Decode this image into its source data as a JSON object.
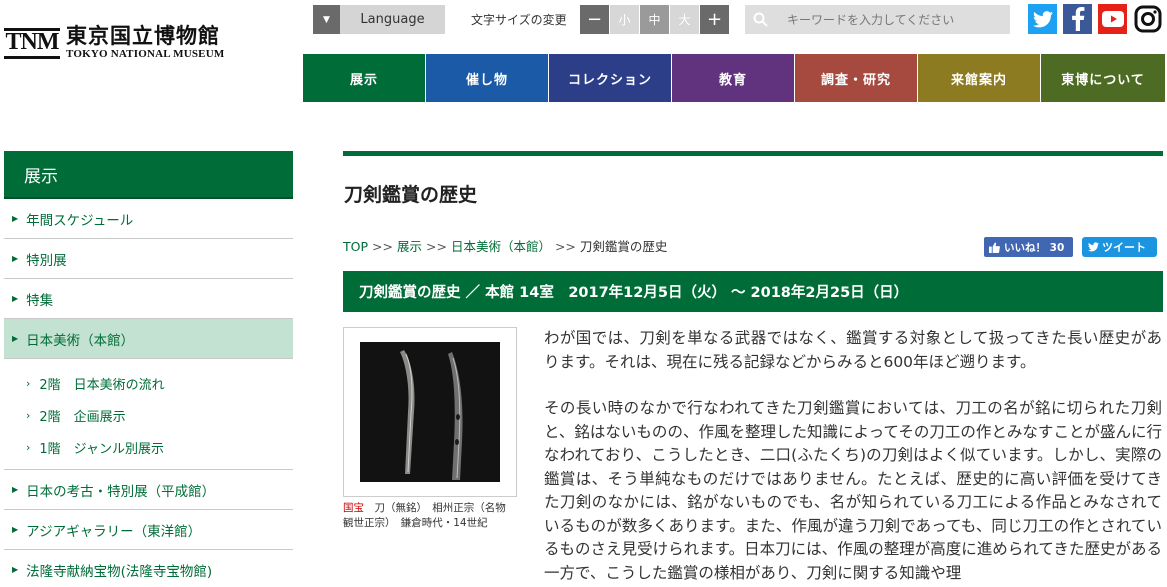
{
  "logo": {
    "mark": "TNM",
    "jp": "東京国立博物館",
    "en": "TOKYO NATIONAL MUSEUM"
  },
  "utility": {
    "language_label": "Language",
    "fontsize_label": "文字サイズの変更",
    "fs_minus": "−",
    "fs_small": "小",
    "fs_mid": "中",
    "fs_large": "大",
    "fs_plus": "+",
    "search_placeholder": "キーワードを入力してください"
  },
  "sns": {
    "twitter_color": "#1da1f2",
    "facebook_color": "#3b5998",
    "youtube_color": "#e62117"
  },
  "gnav": [
    {
      "label": "展示",
      "color": "#006d38"
    },
    {
      "label": "催し物",
      "color": "#1a5aa6"
    },
    {
      "label": "コレクション",
      "color": "#2c3e87"
    },
    {
      "label": "教育",
      "color": "#61337f"
    },
    {
      "label": "調査・研究",
      "color": "#a64a3f"
    },
    {
      "label": "来館案内",
      "color": "#8d7b21"
    },
    {
      "label": "東博について",
      "color": "#4d6b23"
    }
  ],
  "sidebar": {
    "heading": "展示",
    "items": [
      {
        "label": "年間スケジュール"
      },
      {
        "label": "特別展"
      },
      {
        "label": "特集"
      },
      {
        "label": "日本美術（本館）"
      },
      {
        "label": "日本の考古・特別展（平成館）"
      },
      {
        "label": "アジアギャラリー（東洋館）"
      },
      {
        "label": "法隆寺献納宝物(法隆寺宝物館)"
      }
    ],
    "subitems": [
      {
        "label": "2階　日本美術の流れ"
      },
      {
        "label": "2階　企画展示"
      },
      {
        "label": "1階　ジャンル別展示"
      }
    ]
  },
  "main": {
    "title": "刀剣鑑賞の歴史",
    "breadcrumb": {
      "top": "TOP",
      "sep": ">>",
      "c1": "展示",
      "c2": "日本美術（本館）",
      "current": "刀剣鑑賞の歴史"
    },
    "like_label": "いいね！ 30",
    "tweet_label": "ツイート",
    "exhibition_bar": "刀剣鑑賞の歴史 ／ 本館 14室　2017年12月5日（火） 〜 2018年2月25日（日）",
    "caption_red": "国宝",
    "caption_rest": "　刀（無銘）　相州正宗（名物　観世正宗）　鎌倉時代・14世紀",
    "paragraphs": [
      "わが国では、刀剣を単なる武器ではなく、鑑賞する対象として扱ってきた長い歴史があります。それは、現在に残る記録などからみると600年ほど遡ります。",
      "その長い時のなかで行なわれてきた刀剣鑑賞においては、刀工の名が銘に切られた刀剣と、銘はないものの、作風を整理した知識によってその刀工の作とみなすことが盛んに行なわれており、こうしたとき、二口(ふたくち)の刀剣はよく似ています。しかし、実際の鑑賞は、そう単純なものだけではありません。たとえば、歴史的に高い評価を受けてきた刀剣のなかには、銘がないものでも、名が知られている刀工による作品とみなされているものが数多くあります。また、作風が違う刀剣であっても、同じ刀工の作とされているものさえ見受けられます。日本刀には、作風の整理が高度に進められてきた歴史がある一方で、こうした鑑賞の様相があり、刀剣に関する知識や理"
    ]
  }
}
